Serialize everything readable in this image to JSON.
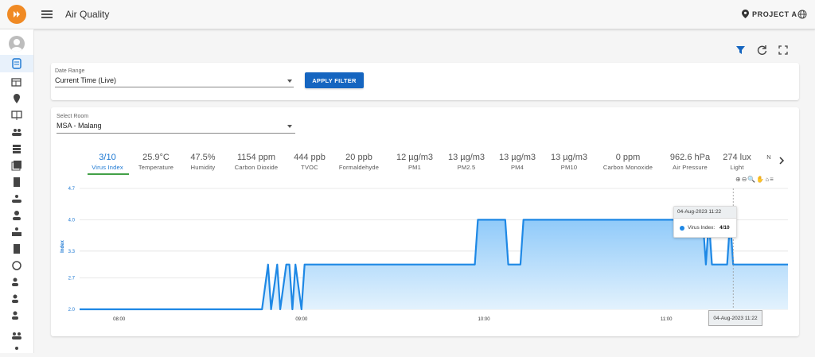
{
  "app": {
    "title": "Air Quality",
    "project_label": "PROJECT A"
  },
  "filters": {
    "date_range_label": "Date Range",
    "date_range_value": "Current Time (Live)",
    "apply_label": "APPLY FILTER",
    "room_label": "Select Room",
    "room_value": "MSA - Malang"
  },
  "metrics": [
    {
      "value": "3/10",
      "label": "Virus Index"
    },
    {
      "value": "25.9°C",
      "label": "Temperature"
    },
    {
      "value": "47.5%",
      "label": "Humidity"
    },
    {
      "value": "1154 ppm",
      "label": "Carbon Dioxide"
    },
    {
      "value": "444 ppb",
      "label": "TVOC"
    },
    {
      "value": "20 ppb",
      "label": "Formaldehyde"
    },
    {
      "value": "12 µg/m3",
      "label": "PM1"
    },
    {
      "value": "13 µg/m3",
      "label": "PM2.5"
    },
    {
      "value": "13 µg/m3",
      "label": "PM4"
    },
    {
      "value": "13 µg/m3",
      "label": "PM10"
    },
    {
      "value": "0 ppm",
      "label": "Carbon Monoxide"
    },
    {
      "value": "962.6 hPa",
      "label": "Air Pressure"
    },
    {
      "value": "274 lux",
      "label": "Light"
    },
    {
      "value": "",
      "label": "N"
    }
  ],
  "tooltip": {
    "date": "04-Aug-2023 11:22",
    "series": "Virus Index:",
    "value": "4/10"
  },
  "x_tooltip": "04-Aug-2023 11:22",
  "colors": {
    "accent": "#1976d2",
    "line": "#1e88e5",
    "fill_top": "#90caf9",
    "fill_bottom": "#e3f2fd",
    "logo": "#f08a24",
    "tab_indicator": "#43a047"
  },
  "icons": [
    "hamburger-icon",
    "location-pin-icon",
    "globe-icon",
    "filter-icon",
    "refresh-icon",
    "fullscreen-icon",
    "chevron-right-icon"
  ],
  "chart_data": {
    "type": "area",
    "ylabel": "Index",
    "ylim": [
      2.0,
      4.7
    ],
    "y_ticks": [
      "4.7",
      "4.0",
      "3.3",
      "2.7",
      "2.0"
    ],
    "x_ticks": [
      "08:00",
      "09:00",
      "10:00",
      "11:00"
    ],
    "grid": true,
    "series": [
      {
        "x": [
          "07:47",
          "08:47",
          "08:49",
          "08:50",
          "08:52",
          "08:53",
          "08:55",
          "08:56",
          "08:57",
          "08:58",
          "09:00",
          "09:01",
          "09:03",
          "09:04",
          "09:57",
          "09:58",
          "10:07",
          "10:08",
          "10:12",
          "10:13",
          "11:12",
          "11:13",
          "11:14",
          "11:15",
          "11:16",
          "11:17",
          "11:20",
          "11:21",
          "11:22",
          "11:23",
          "11:40"
        ],
        "values": [
          2.0,
          2.0,
          3.0,
          2.0,
          3.0,
          2.0,
          3.0,
          3.0,
          2.0,
          3.0,
          2.0,
          3.0,
          3.0,
          3.0,
          3.0,
          4.0,
          4.0,
          3.0,
          3.0,
          4.0,
          4.0,
          3.0,
          4.0,
          3.0,
          3.0,
          3.0,
          3.0,
          4.0,
          3.0,
          3.0,
          3.0
        ]
      }
    ]
  }
}
